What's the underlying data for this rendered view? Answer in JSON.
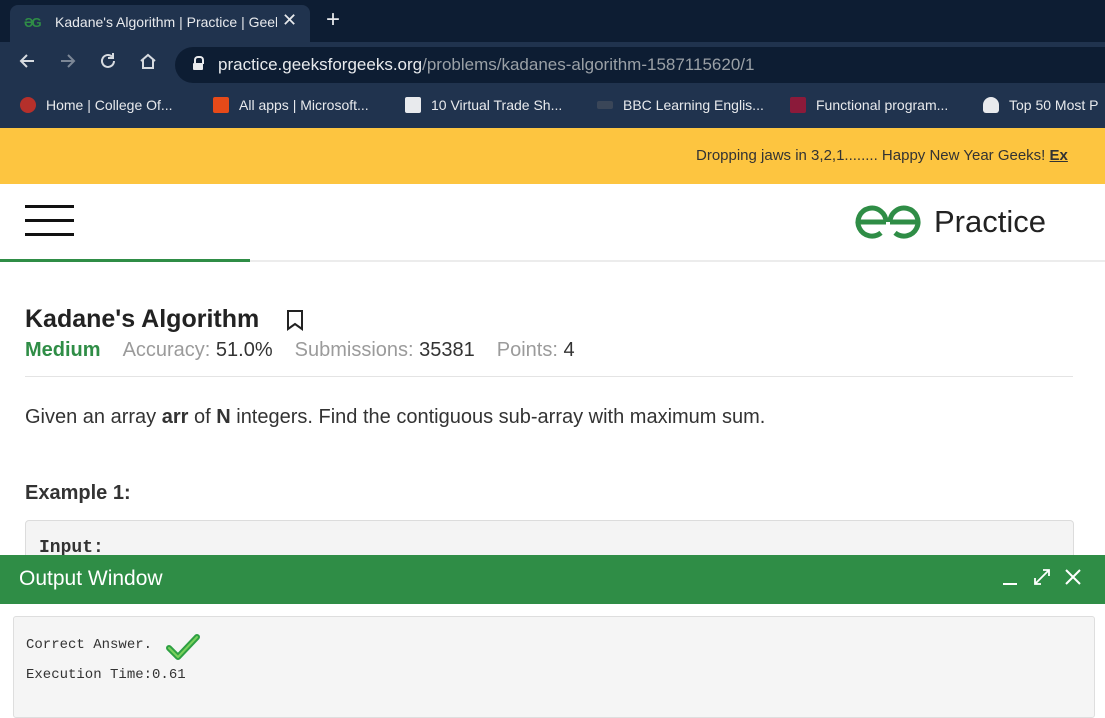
{
  "browser": {
    "tab_title": "Kadane's Algorithm | Practice | GeeksforGeeks",
    "new_tab_symbol": "+",
    "close_tab_symbol": "✕",
    "url_host": "practice.geeksforgeeks.org",
    "url_path": "/problems/kadanes-algorithm-1587115620/1",
    "bookmarks": [
      {
        "label": "Home | College Of...",
        "icon": "college-crest-icon",
        "color": "#b5302b"
      },
      {
        "label": "All apps | Microsoft...",
        "icon": "office-icon",
        "color": "#e64a19"
      },
      {
        "label": "10 Virtual Trade Sh...",
        "icon": "e-square-icon",
        "color": "#333333"
      },
      {
        "label": "BBC Learning Englis...",
        "icon": "bbc-icon",
        "color": "#222222"
      },
      {
        "label": "Functional program...",
        "icon": "iw-icon",
        "color": "#8b1a3a"
      },
      {
        "label": "Top 50 Most P",
        "icon": "octopus-icon",
        "color": "#e8eaed"
      }
    ]
  },
  "banner": {
    "text": "Dropping jaws in 3,2,1........ Happy New Year Geeks! ",
    "link_text": "Ex"
  },
  "site": {
    "brand_name": "Practice",
    "brand_color": "#2f8d46"
  },
  "problem": {
    "title": "Kadane's Algorithm",
    "difficulty": "Medium",
    "accuracy_label": "Accuracy: ",
    "accuracy_value": "51.0%",
    "submissions_label": "Submissions: ",
    "submissions_value": "35381",
    "points_label": "Points: ",
    "points_value": "4",
    "description_parts": [
      "Given an array ",
      "arr",
      " of ",
      "N",
      " integers. Find the contiguous sub-array with maximum sum."
    ],
    "example_heading": "Example 1:",
    "example_input_label": "Input:"
  },
  "output_window": {
    "title": "Output Window",
    "line1": "Correct Answer.",
    "line2": "Execution Time:0.61"
  }
}
